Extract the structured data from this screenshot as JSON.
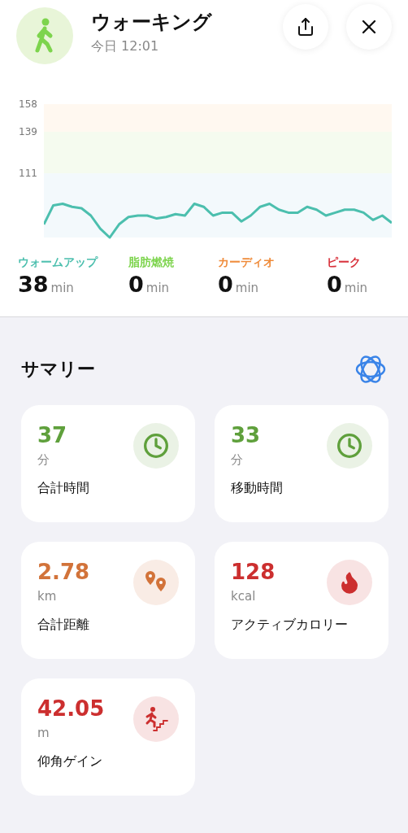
{
  "header": {
    "title": "ウォーキング",
    "subtitle": "今日 12:01"
  },
  "heart_rate": {
    "axis_labels": [
      "158",
      "139",
      "111"
    ]
  },
  "zones": [
    {
      "label": "ウォームアップ",
      "value": "38",
      "unit": "min",
      "color": "#4cbfae"
    },
    {
      "label": "脂肪燃焼",
      "value": "0",
      "unit": "min",
      "color": "#7dd44d"
    },
    {
      "label": "カーディオ",
      "value": "0",
      "unit": "min",
      "color": "#ef8b3a"
    },
    {
      "label": "ピーク",
      "value": "0",
      "unit": "min",
      "color": "#d8303a"
    }
  ],
  "summary": {
    "title": "サマリー",
    "cards": [
      {
        "kind": "clock",
        "value": "37",
        "unit": "分",
        "label": "合計時間",
        "color": "#5fa03c"
      },
      {
        "kind": "clock",
        "value": "33",
        "unit": "分",
        "label": "移動時間",
        "color": "#5fa03c"
      },
      {
        "kind": "pins",
        "value": "2.78",
        "unit": "km",
        "label": "合計距離",
        "color": "#d2733a"
      },
      {
        "kind": "flame",
        "value": "128",
        "unit": "kcal",
        "label": "アクティブカロリー",
        "color": "#cc2f2f"
      },
      {
        "kind": "stairs",
        "value": "42.05",
        "unit": "m",
        "label": "仰角ゲイン",
        "color": "#cc2f2f"
      }
    ]
  }
}
